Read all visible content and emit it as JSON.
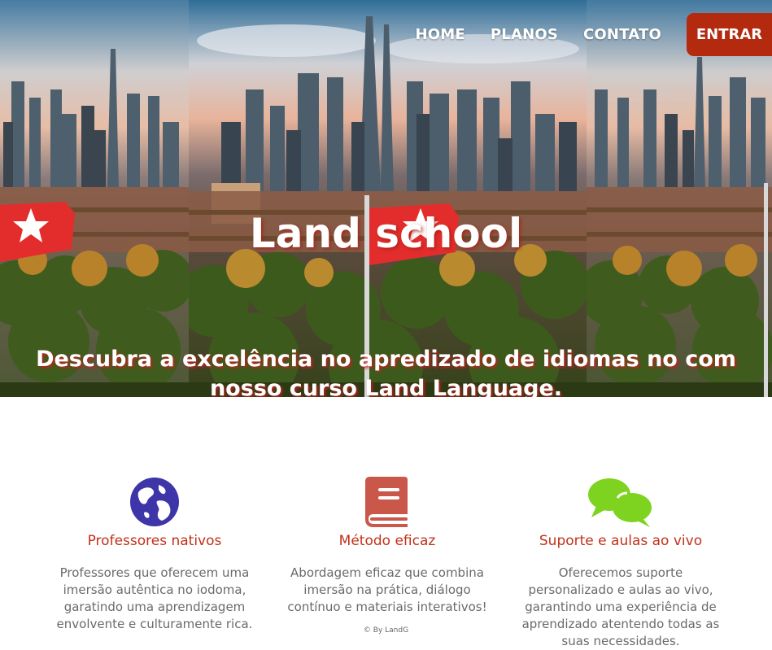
{
  "nav": {
    "links": [
      "HOME",
      "PLANOS",
      "CONTATO"
    ],
    "login_label": "ENTRAR"
  },
  "hero": {
    "title": "Land school",
    "subtitle": "Descubra a excelência no apredizado de idiomas no com nosso curso Land Language."
  },
  "features": [
    {
      "icon": "globe-icon",
      "title": "Professores nativos",
      "text": "Professores que oferecem uma imersão autêntica no iodoma, garatindo uma aprendizagem envolvente e culturamente rica."
    },
    {
      "icon": "book-icon",
      "title": "Método eficaz",
      "text": "Abordagem eficaz que combina imersão na prática, diálogo contínuo e materiais interativos!"
    },
    {
      "icon": "chat-bubbles-icon",
      "title": "Suporte e aulas ao vivo",
      "text": "Oferecemos suporte personalizado e aulas ao vivo, garantindo uma experiência de aprendizado atentendo todas as suas necessidades."
    }
  ],
  "footer": {
    "note": "© By LandG"
  },
  "colors": {
    "accent": "#b32a0f",
    "feature_title": "#c2311a",
    "globe_icon": "#3d35a8",
    "book_icon": "#c9574a",
    "chat_icon": "#7ed321"
  }
}
